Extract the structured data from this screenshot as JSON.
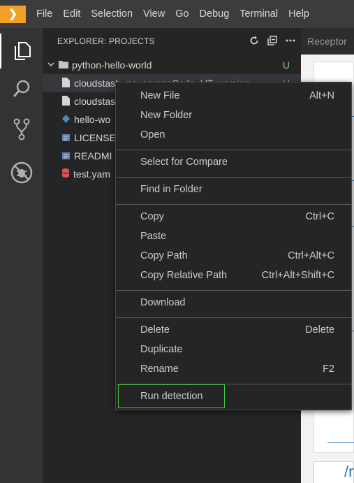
{
  "menubar": {
    "logo_glyph": "❯",
    "items": [
      "File",
      "Edit",
      "Selection",
      "View",
      "Go",
      "Debug",
      "Terminal",
      "Help"
    ]
  },
  "activity": {
    "icons": [
      "files-icon",
      "search-icon",
      "source-control-icon",
      "debug-icon"
    ]
  },
  "sidebar": {
    "title": "EXPLORER: PROJECTS",
    "actions": [
      "refresh-icon",
      "collapse-all-icon",
      "more-icon"
    ],
    "tree": [
      {
        "label": "python-hello-world",
        "status": "U",
        "type": "folder"
      },
      {
        "label": "cloudstash_no_sourceCode_VT_version",
        "status": "U",
        "type": "file"
      },
      {
        "label": "cloudstas",
        "status": "",
        "type": "file"
      },
      {
        "label": "hello-wo",
        "status": "",
        "type": "python"
      },
      {
        "label": "LICENSE",
        "status": "",
        "type": "doc"
      },
      {
        "label": "READMI",
        "status": "",
        "type": "doc"
      },
      {
        "label": "test.yam",
        "status": "",
        "type": "yaml"
      }
    ]
  },
  "editor": {
    "tab_label": "Receptor",
    "fragment_text": "/r"
  },
  "context_menu": {
    "groups": [
      [
        {
          "label": "New File",
          "shortcut": "Alt+N"
        },
        {
          "label": "New Folder",
          "shortcut": ""
        },
        {
          "label": "Open",
          "shortcut": ""
        }
      ],
      [
        {
          "label": "Select for Compare",
          "shortcut": ""
        }
      ],
      [
        {
          "label": "Find in Folder",
          "shortcut": ""
        }
      ],
      [
        {
          "label": "Copy",
          "shortcut": "Ctrl+C"
        },
        {
          "label": "Paste",
          "shortcut": ""
        },
        {
          "label": "Copy Path",
          "shortcut": "Ctrl+Alt+C"
        },
        {
          "label": "Copy Relative Path",
          "shortcut": "Ctrl+Alt+Shift+C"
        }
      ],
      [
        {
          "label": "Download",
          "shortcut": ""
        }
      ],
      [
        {
          "label": "Delete",
          "shortcut": "Delete"
        },
        {
          "label": "Duplicate",
          "shortcut": ""
        },
        {
          "label": "Rename",
          "shortcut": "F2"
        }
      ],
      [
        {
          "label": "Run detection",
          "shortcut": ""
        }
      ]
    ]
  },
  "colors": {
    "accent_logo": "#f1a025",
    "git_untracked": "#73c991",
    "highlight_box": "#3ecf3e"
  }
}
